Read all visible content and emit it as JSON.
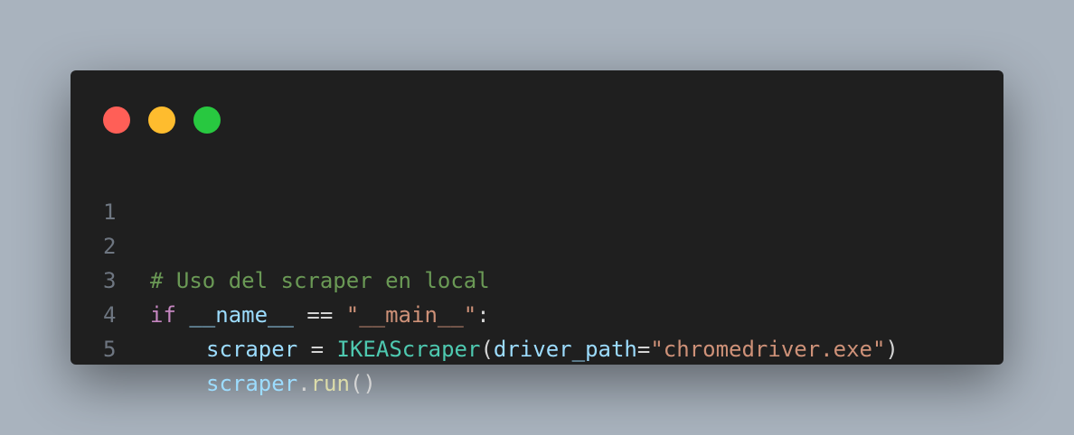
{
  "colors": {
    "background": "#a9b3be",
    "window": "#1f1f1f",
    "dot_red": "#ff5f57",
    "dot_yellow": "#febc2e",
    "dot_green": "#28c840",
    "line_number": "#6e7681",
    "comment": "#6a9955",
    "keyword": "#c586c0",
    "variable": "#9cdcfe",
    "string": "#ce9178",
    "class": "#4ec9b0",
    "function": "#dcdcaa",
    "operator": "#d4d4d4"
  },
  "code": {
    "line_numbers": [
      "1",
      "2",
      "3",
      "4",
      "5"
    ],
    "line2": {
      "comment": "# Uso del scraper en local"
    },
    "line3": {
      "kw_if": "if",
      "var_name": "__name__",
      "op_eq": " == ",
      "str_main": "\"__main__\"",
      "colon": ":"
    },
    "line4": {
      "var_scraper": "scraper",
      "op_assign": " = ",
      "class_name": "IKEAScraper",
      "paren_open": "(",
      "param": "driver_path",
      "op_kw": "=",
      "str_path": "\"chromedriver.exe\"",
      "paren_close": ")"
    },
    "line5": {
      "var_scraper": "scraper",
      "dot": ".",
      "func_run": "run",
      "parens": "()"
    }
  }
}
